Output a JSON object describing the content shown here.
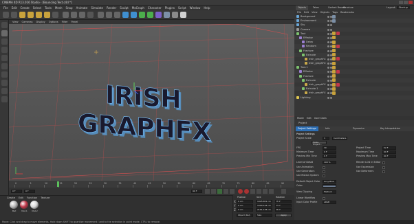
{
  "window": {
    "title": "CINEMA 4D R13.016 Studio - [Bouncing Text.c4d *]",
    "layout_label": "Layout:",
    "layout_value": "Startup"
  },
  "menubar": [
    "File",
    "Edit",
    "Create",
    "Select",
    "Tools",
    "Mesh",
    "Snap",
    "Animate",
    "Simulate",
    "Render",
    "Sculpt",
    "MoGraph",
    "Character",
    "Plugins",
    "Script",
    "Window",
    "Help"
  ],
  "viewport": {
    "menu": [
      "View",
      "Cameras",
      "Display",
      "Options",
      "Filter",
      "Panel"
    ],
    "scene_text": [
      "IRISH",
      "GRAPHFX"
    ]
  },
  "timeline": {
    "ticks": [
      "0",
      "5",
      "10",
      "15",
      "20",
      "25",
      "30",
      "35",
      "40",
      "45",
      "50",
      "55",
      "60",
      "65",
      "70",
      "75",
      "80",
      "85",
      "90"
    ],
    "current_frame": "0 F",
    "start": "0 F",
    "end": "90 F"
  },
  "materials": {
    "menu": [
      "Create",
      "Edit",
      "Function",
      "Texture"
    ],
    "items": [
      {
        "name": "Mat",
        "color": "#b8b8b8"
      },
      {
        "name": "Mat.1",
        "color": "#c0394a"
      },
      {
        "name": "Mat.2",
        "color": "#d8d8d8"
      }
    ]
  },
  "coordinates": {
    "headers": [
      "Position",
      "Size",
      "Rotation"
    ],
    "rows": [
      {
        "axis": "X",
        "pos": "0 cm",
        "size": "1925.651 cm",
        "rot": "H 0°"
      },
      {
        "axis": "Y",
        "pos": "0 cm",
        "size": "1000.144 cm",
        "rot": "P 0°"
      },
      {
        "axis": "Z",
        "pos": "0 cm",
        "size": "2161.178 cm",
        "rot": "B 0°"
      }
    ],
    "mode": "Object (Rel)",
    "size_mode": "Size",
    "apply": "Apply"
  },
  "status": "Move: Click and drag to move elements. Hold down SHIFT to quantize movement / add to the selection in point mode, CTRL to remove.",
  "object_manager": {
    "tabs": [
      "Objects",
      "Takes",
      "Content Browser",
      "Structure"
    ],
    "menu": [
      "File",
      "Edit",
      "View",
      "Objects",
      "Tags",
      "Bookmarks"
    ],
    "items": [
      {
        "name": "Background",
        "indent": 0,
        "icon": "#6aa7d8"
      },
      {
        "name": "Environment",
        "indent": 0,
        "icon": "#6aa7d8"
      },
      {
        "name": "Sky",
        "indent": 0,
        "icon": "#6aa7d8"
      },
      {
        "name": "Camera",
        "indent": 0,
        "icon": "#999"
      },
      {
        "name": "Text",
        "indent": 0,
        "icon": "#7dc36f"
      },
      {
        "name": "Effector",
        "indent": 1,
        "icon": "#9b7fd1"
      },
      {
        "name": "Delay",
        "indent": 2,
        "icon": "#9b7fd1"
      },
      {
        "name": "Random",
        "indent": 2,
        "icon": "#9b7fd1"
      },
      {
        "name": "Fracture",
        "indent": 1,
        "icon": "#7dc36f"
      },
      {
        "name": "Extrude",
        "indent": 2,
        "icon": "#7dc36f"
      },
      {
        "name": "Irish_graphFX",
        "indent": 3,
        "icon": "#c9a94a"
      },
      {
        "name": "Irish_graphFX",
        "indent": 3,
        "icon": "#c9a94a"
      },
      {
        "name": "Text.1",
        "indent": 0,
        "icon": "#7dc36f"
      },
      {
        "name": "Effector",
        "indent": 1,
        "icon": "#9b7fd1"
      },
      {
        "name": "Fracture",
        "indent": 1,
        "icon": "#7dc36f"
      },
      {
        "name": "Extrude",
        "indent": 2,
        "icon": "#7dc36f"
      },
      {
        "name": "Irish_graphFX",
        "indent": 3,
        "icon": "#c9a94a"
      },
      {
        "name": "Extrude.1",
        "indent": 2,
        "icon": "#7dc36f"
      },
      {
        "name": "Irish_graphFX",
        "indent": 3,
        "icon": "#c9a94a"
      },
      {
        "name": "Lighting",
        "indent": 0,
        "icon": "#e0c850"
      }
    ]
  },
  "attribute_manager": {
    "menu": [
      "Mode",
      "Edit",
      "User Data"
    ],
    "header": "Project",
    "tabs": [
      "Project Settings",
      "Info",
      "Dynamics",
      "Key Interpolation"
    ],
    "section": "Project Settings",
    "fields": [
      {
        "label": "Project Scale",
        "value": "1",
        "unit": "Centimeters"
      },
      {
        "label": "Scale Project...",
        "value": ""
      },
      {
        "label": "FPS",
        "value": "30"
      },
      {
        "label": "Project Time",
        "value": "52 F"
      },
      {
        "label": "Minimum Time",
        "value": "0 F"
      },
      {
        "label": "Maximum Time",
        "value": "90 F"
      },
      {
        "label": "Preview Min Time",
        "value": "0 F"
      },
      {
        "label": "Preview Max Time",
        "value": "90 F"
      },
      {
        "label": "Level of Detail",
        "value": "100 %"
      },
      {
        "label": "Render LOD in Editor",
        "value": ""
      },
      {
        "label": "Use Animation",
        "value": ""
      },
      {
        "label": "Use Expression",
        "value": ""
      },
      {
        "label": "Use Generators",
        "value": ""
      },
      {
        "label": "Use Deformers",
        "value": ""
      },
      {
        "label": "Use Motion System",
        "value": ""
      },
      {
        "label": "Default Object Color",
        "value": "Gray-Blue"
      },
      {
        "label": "Color",
        "value": ""
      },
      {
        "label": "View Clipping",
        "value": "Medium"
      },
      {
        "label": "Linear Workflow",
        "value": ""
      },
      {
        "label": "Input Color Profile",
        "value": "sRGB"
      }
    ]
  },
  "colors": {
    "accent": "#2d6fb5",
    "grid": "#c84c4c",
    "text_face": "#1a1a2e",
    "text_glow": "#5ab4ff"
  }
}
